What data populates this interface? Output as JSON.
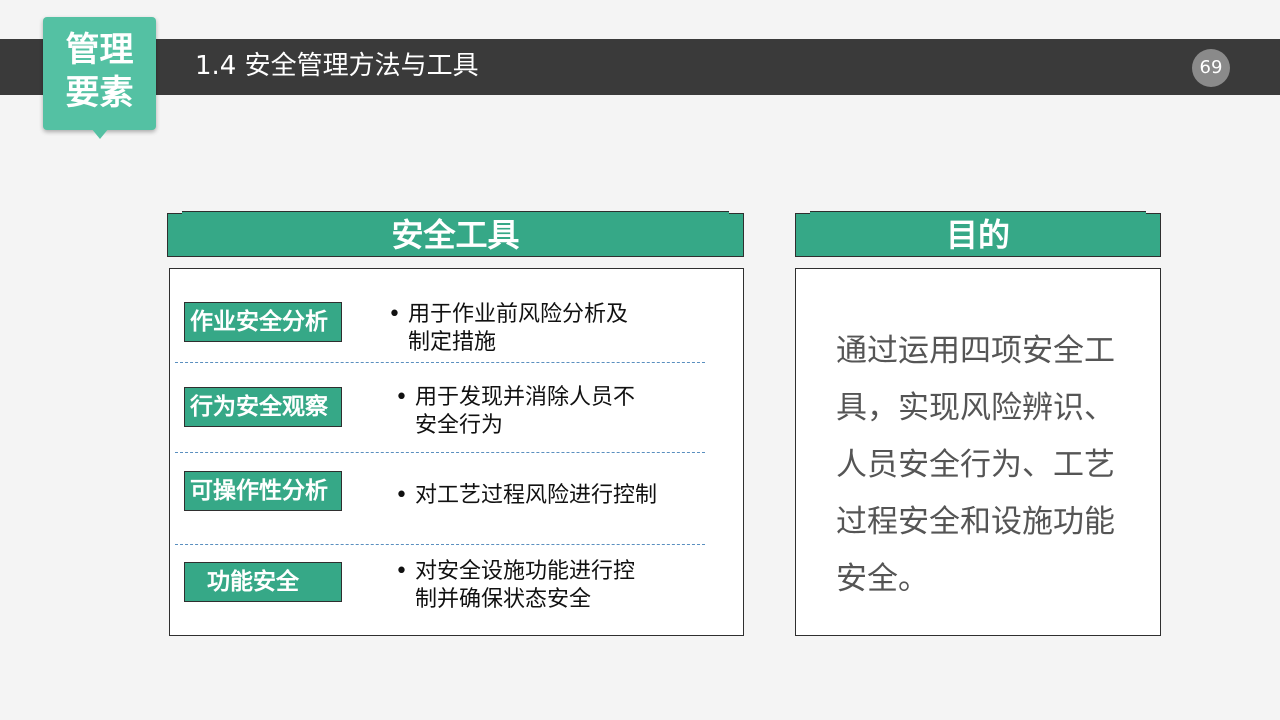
{
  "header": {
    "badge_line1": "管理",
    "badge_line2": "要素",
    "title": "1.4 安全管理方法与工具",
    "page_number": "69"
  },
  "tools_panel": {
    "heading": "安全工具",
    "items": [
      {
        "tag": "作业安全分析",
        "desc_line1": "用于作业前风险分析及",
        "desc_line2": "制定措施"
      },
      {
        "tag": "行为安全观察",
        "desc_line1": "用于发现并消除人员不",
        "desc_line2": "安全行为"
      },
      {
        "tag": "可操作性分析",
        "desc_line1": "对工艺过程风险进行控制",
        "desc_line2": ""
      },
      {
        "tag": "功能安全",
        "desc_line1": "对安全设施功能进行控",
        "desc_line2": "制并确保状态安全"
      }
    ]
  },
  "purpose_panel": {
    "heading": "目的",
    "text": "通过运用四项安全工具，实现风险辨识、人员安全行为、工艺过程安全和设施功能安全。"
  },
  "colors": {
    "accent": "#36a887",
    "badge": "#54c1a3",
    "topbar": "#3a3a3a"
  }
}
